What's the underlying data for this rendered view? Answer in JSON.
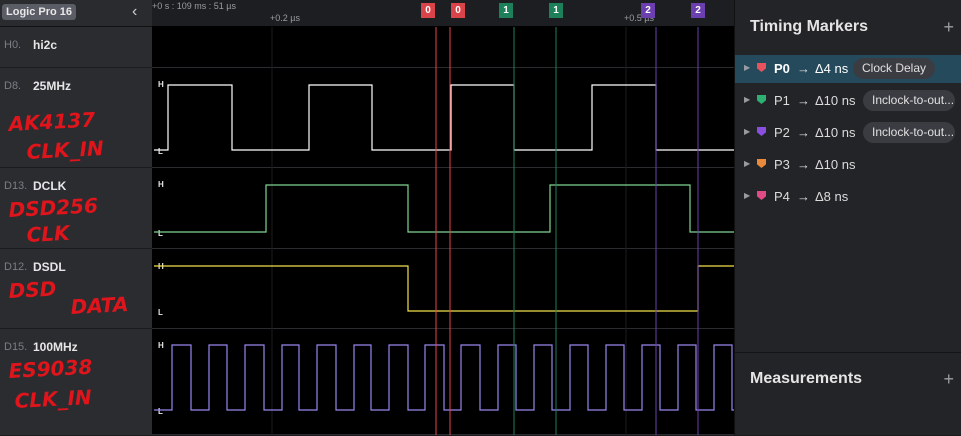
{
  "app": {
    "device_badge": "Logic Pro 16"
  },
  "channels": [
    {
      "id": "H0.",
      "name": "hi2c"
    },
    {
      "id": "D8.",
      "name": "25MHz"
    },
    {
      "id": "D13.",
      "name": "DCLK"
    },
    {
      "id": "D12.",
      "name": "DSDL"
    },
    {
      "id": "D15.",
      "name": "100MHz"
    }
  ],
  "annotations": {
    "d8_line1": "AK4137",
    "d8_line2": "CLK_IN",
    "d13_line1": "DSD256",
    "d13_line2": "CLK",
    "d12_line1": "DSD",
    "d12_line2": "DATA",
    "d15_line1": "ES9038",
    "d15_line2": "CLK_IN"
  },
  "ruler": {
    "start_label": "+0 s : 109 ms : 51 µs",
    "tick1_label": "+0.2 µs",
    "tick2_label": "+0.5 µs"
  },
  "level_labels": {
    "high": "H",
    "low": "L"
  },
  "marker_flags": [
    {
      "label": "0",
      "color": "#d9434a"
    },
    {
      "label": "0",
      "color": "#d9434a"
    },
    {
      "label": "1",
      "color": "#1e7f5b"
    },
    {
      "label": "1",
      "color": "#1e7f5b"
    },
    {
      "label": "2",
      "color": "#6b3fb0"
    },
    {
      "label": "2",
      "color": "#6b3fb0"
    }
  ],
  "colors": {
    "d8": "#ffffff",
    "d13": "#7fd48f",
    "d12": "#f3e14a",
    "d15": "#9a86ee",
    "marker0": "#e8454d",
    "marker1": "#1e7f5b",
    "marker2": "#6b3fb0",
    "selected_row": "#254a5c"
  },
  "timing_markers": {
    "title": "Timing Markers",
    "add_icon": "+",
    "items": [
      {
        "name": "P0",
        "arrow": "→",
        "delta": "Δ4 ns",
        "tag": "Clock Delay",
        "color": "#e8525c",
        "selected": true
      },
      {
        "name": "P1",
        "arrow": "→",
        "delta": "Δ10 ns",
        "tag": "Inclock-to-out...",
        "color": "#2fb073"
      },
      {
        "name": "P2",
        "arrow": "→",
        "delta": "Δ10 ns",
        "tag": "Inclock-to-out...",
        "color": "#8b4fe0"
      },
      {
        "name": "P3",
        "arrow": "→",
        "delta": "Δ10 ns",
        "tag": "",
        "color": "#e88a3a"
      },
      {
        "name": "P4",
        "arrow": "→",
        "delta": "Δ8 ns",
        "tag": "",
        "color": "#e04a86"
      }
    ]
  },
  "measurements": {
    "title": "Measurements",
    "add_icon": "+"
  }
}
